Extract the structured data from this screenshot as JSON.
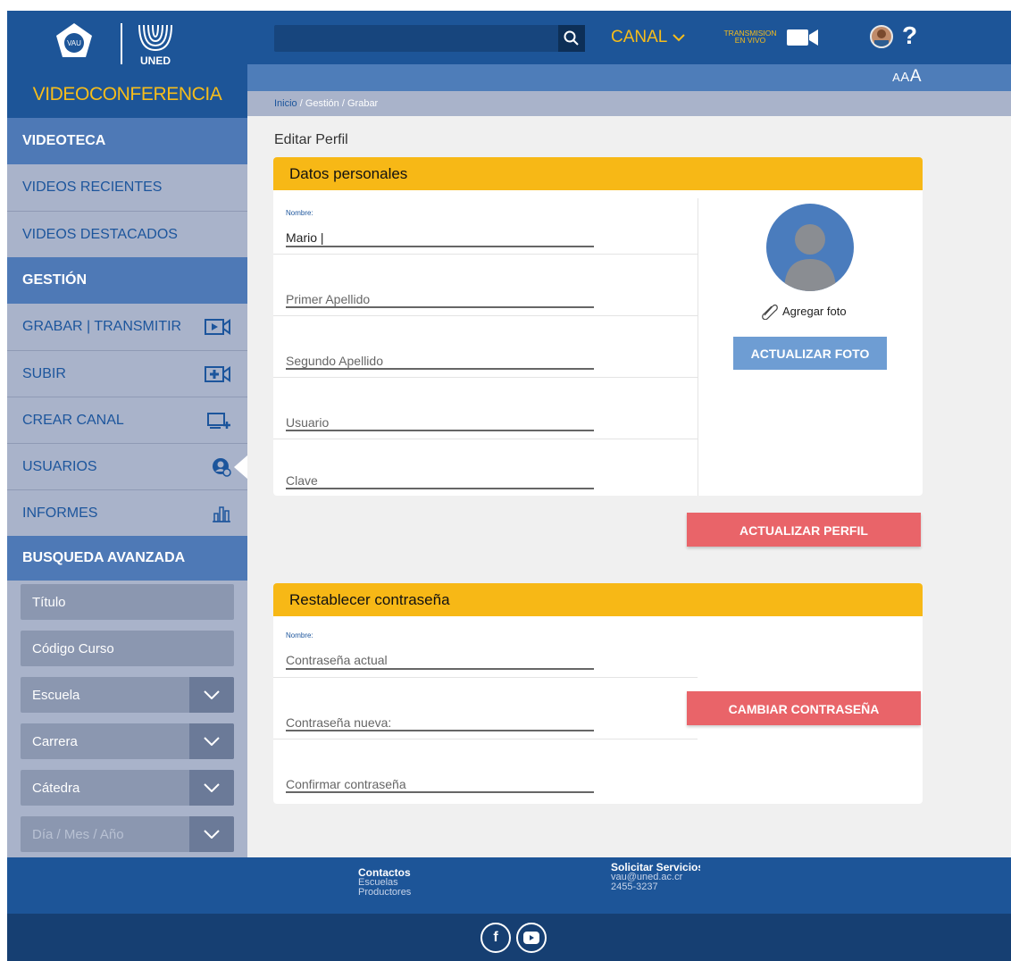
{
  "brand": {
    "title": "VIDEOCONFERENCIA",
    "vau": "VAU",
    "uned": "UNED"
  },
  "sidebar": {
    "videoteca": "VIDEOTECA",
    "recientes": "VIDEOS RECIENTES",
    "destacados": "VIDEOS DESTACADOS",
    "gestion": "GESTIÓN",
    "items": [
      {
        "label": "GRABAR | TRANSMITIR",
        "icon": "record-video-icon"
      },
      {
        "label": "SUBIR",
        "icon": "upload-video-icon"
      },
      {
        "label": "CREAR CANAL",
        "icon": "create-channel-icon"
      },
      {
        "label": "USUARIOS",
        "icon": "users-icon"
      },
      {
        "label": "INFORMES",
        "icon": "reports-icon"
      }
    ],
    "busqueda": "BUSQUEDA AVANZADA",
    "filters": {
      "titulo": "Título",
      "codigo": "Código Curso",
      "escuela": "Escuela",
      "carrera": "Carrera",
      "catedra": "Cátedra",
      "fecha": "Día / Mes / Año"
    }
  },
  "topbar": {
    "canal": "CANAL",
    "live_1": "TRANSMISION",
    "live_2": "EN VIVO",
    "help": "?",
    "font_small": "A",
    "font_mid": "A",
    "font_big": "A"
  },
  "breadcrumb": {
    "home": "Inicio",
    "gestion": "Gestión",
    "grabar": "Grabar",
    "sep": "/"
  },
  "main": {
    "title": "Editar Perfil",
    "personal": {
      "heading": "Datos personales",
      "nombre_label": "Nombre:",
      "nombre_value": "Mario |",
      "apellido1": "Primer Apellido",
      "apellido2": "Segundo Apellido",
      "usuario": "Usuario",
      "clave": "Clave",
      "add_photo": "Agregar foto",
      "btn_photo": "ACTUALIZAR FOTO",
      "btn_update": "ACTUALIZAR PERFIL"
    },
    "password": {
      "heading": "Restablecer contraseña",
      "nombre_label": "Nombre:",
      "actual": "Contraseña actual",
      "nueva": "Contraseña nueva:",
      "confirmar": "Confirmar contraseña",
      "btn_change": "CAMBIAR CONTRASEÑA"
    }
  },
  "footer": {
    "contactos": "Contactos",
    "escuelas": "Escuelas",
    "productores": "Productores",
    "servicios": "Solicitar Servicios",
    "email": "vau@uned.ac.cr",
    "phone": "2455-3237",
    "facebook": "f"
  },
  "colors": {
    "brand_blue": "#1d5598",
    "accent_yellow": "#f7b816",
    "button_red": "#e96469",
    "button_blue": "#6e9dd3"
  }
}
